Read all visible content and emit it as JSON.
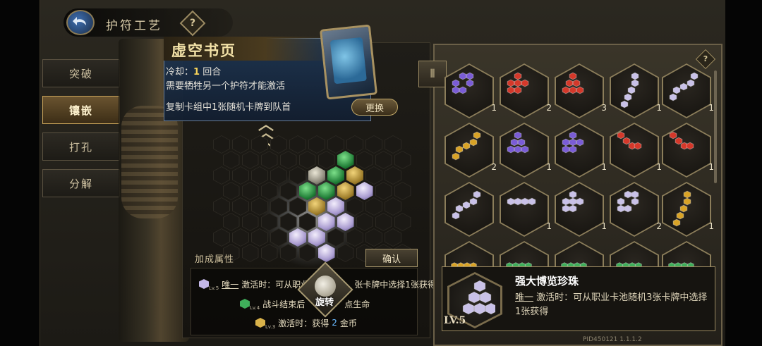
{
  "header": {
    "title": "护符工艺",
    "back_icon": "back-arrow-icon",
    "help_glyph": "?"
  },
  "tabs": [
    {
      "label": "突破",
      "active": false
    },
    {
      "label": "镶嵌",
      "active": true
    },
    {
      "label": "打孔",
      "active": false
    },
    {
      "label": "分解",
      "active": false
    }
  ],
  "tooltip": {
    "card_name": "虚空书页",
    "cooldown_prefix": "冷却：",
    "cooldown_value": "1",
    "cooldown_suffix": "回合",
    "requirement": "需要牺牲另一个护符才能激活",
    "effect": "复制卡组中1张随机卡牌到队首",
    "swap_label": "更换"
  },
  "board": {
    "bonus_label": "加成属性",
    "confirm_label": "确认",
    "rotate_label": "旋转",
    "bonuses": [
      {
        "level": "Lv.5",
        "color": "#c4b8e8",
        "tag": "唯一",
        "text": "激活时：可从职业卡",
        "trail": "张卡牌中选择1张获得"
      },
      {
        "level": "Lv.4",
        "color": "#3fae5a",
        "prefix": "战斗结束后",
        "text": "点生命"
      },
      {
        "level": "Lv.3",
        "color": "#d9b24a",
        "text": "激活时：获得",
        "value": "2",
        "unit": "金币"
      }
    ]
  },
  "inventory": {
    "toggle_icon": "bars-icon",
    "help_glyph": "?",
    "slots": [
      {
        "color": "#7a5cd6",
        "shape": "ring",
        "count": "1"
      },
      {
        "color": "#d4382a",
        "shape": "cluster",
        "count": "2"
      },
      {
        "color": "#d4382a",
        "shape": "pyramid",
        "count": "3"
      },
      {
        "color": "#c9c1e8",
        "shape": "snake",
        "count": "1"
      },
      {
        "color": "#c9c1e8",
        "shape": "stairs",
        "count": "1"
      },
      {
        "color": "#d9a326",
        "shape": "stairs",
        "count": "2"
      },
      {
        "color": "#7a5cd6",
        "shape": "pyramid",
        "count": "1"
      },
      {
        "color": "#7a5cd6",
        "shape": "cluster",
        "count": "1"
      },
      {
        "color": "#d4382a",
        "shape": "wave",
        "count": "1"
      },
      {
        "color": "#d4382a",
        "shape": "wave",
        "count": "1"
      },
      {
        "color": "#c9c1e8",
        "shape": "stairs",
        "count": ""
      },
      {
        "color": "#c9c1e8",
        "shape": "line",
        "count": "1"
      },
      {
        "color": "#c9c1e8",
        "shape": "cluster",
        "count": "1"
      },
      {
        "color": "#c9c1e8",
        "shape": "ring",
        "count": "2"
      },
      {
        "color": "#d9a326",
        "shape": "snake",
        "count": "1"
      }
    ]
  },
  "detail": {
    "name": "强大博览珍珠",
    "desc_tag": "唯一",
    "desc": "激活时：可从职业卡池随机3张卡牌中选择1张获得",
    "level": "LV.5"
  },
  "build_id": "PID450121  1.1.1.2"
}
